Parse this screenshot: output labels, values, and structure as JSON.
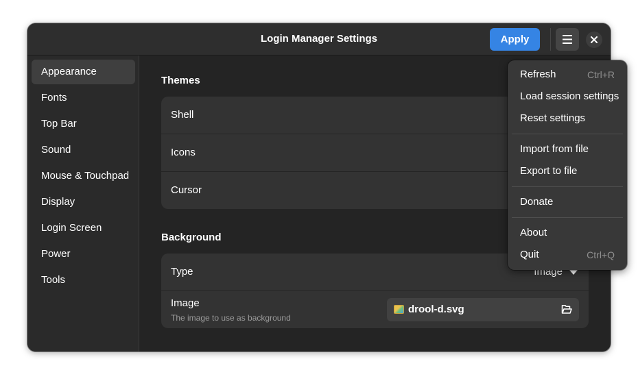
{
  "window": {
    "title": "Login Manager Settings",
    "apply_label": "Apply",
    "menu_icon": "hamburger-menu-icon",
    "close_icon": "close-icon",
    "accent_color": "#3584e4"
  },
  "sidebar": {
    "items": [
      {
        "label": "Appearance",
        "active": true
      },
      {
        "label": "Fonts"
      },
      {
        "label": "Top Bar"
      },
      {
        "label": "Sound"
      },
      {
        "label": "Mouse & Touchpad"
      },
      {
        "label": "Display"
      },
      {
        "label": "Login Screen"
      },
      {
        "label": "Power"
      },
      {
        "label": "Tools"
      }
    ]
  },
  "main": {
    "themes": {
      "title": "Themes",
      "rows": [
        {
          "label": "Shell"
        },
        {
          "label": "Icons"
        },
        {
          "label": "Cursor"
        }
      ]
    },
    "background": {
      "title": "Background",
      "type": {
        "label": "Type",
        "value": "Image"
      },
      "image": {
        "label": "Image",
        "subtitle": "The image to use as background",
        "file": "drool-d.svg",
        "folder_icon": "folder-open-icon"
      }
    }
  },
  "menu": {
    "items": [
      {
        "label": "Refresh",
        "accel": "Ctrl+R"
      },
      {
        "label": "Load session settings"
      },
      {
        "label": "Reset settings"
      },
      {
        "label": "Import from file"
      },
      {
        "label": "Export to file"
      },
      {
        "label": "Donate"
      },
      {
        "label": "About"
      },
      {
        "label": "Quit",
        "accel": "Ctrl+Q"
      }
    ]
  }
}
